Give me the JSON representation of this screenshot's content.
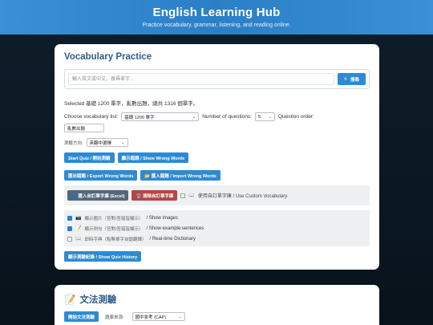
{
  "hero": {
    "title": "English Learning Hub",
    "subtitle": "Practice vocabulary, grammar, listening, and reading online."
  },
  "vocab": {
    "title": "Vocabulary Practice",
    "search_placeholder": "輸入英文或中文，搜尋單字...",
    "search_button": "🔍 搜尋",
    "selected_info": "Selected 基礎 1200 單字，亂數出題，總共 1316 個單字。",
    "list_label": "Choose vocabulary list:",
    "list_value": "基礎 1200 單字",
    "questions_label": "Number of questions:",
    "questions_value": "5",
    "order_label": "Question order:",
    "order_value": "亂數出題",
    "direction_label": "測驗方向:",
    "direction_value": "英翻中選擇",
    "start_button": "Start Quiz / 開始測驗",
    "wrong_button": "顯示錯題 / Show Wrong Words",
    "export_button": "匯出錯題 / Export Wrong Words",
    "import_button": "📂 匯入錯題 / Import Wrong Words",
    "custom_import_button": "👤 匯入自訂單字庫 (Excel)",
    "custom_clear_button": "🗑️ 清除自訂單字庫",
    "custom_use_label": "使用自訂單字庫 / Use Custom Vocabulary",
    "options": [
      {
        "zh": "顯示圖片（答對/答錯皆顯示）",
        "en": " / Show images",
        "checked": true,
        "icon": "📷"
      },
      {
        "zh": "顯示例句（答對/答錯皆顯示）",
        "en": " / Show example sentences",
        "checked": true,
        "icon": "📝"
      },
      {
        "zh": "即時字典（點擊單字自動翻譯）",
        "en": " / Real-time Dictionary",
        "checked": false,
        "icon": "📖"
      }
    ],
    "history_button": "顯示測驗紀錄 / Show Quiz History"
  },
  "grammar": {
    "title": "文法測驗",
    "start_button": "開始文法測驗",
    "source_label": "題庫來源:",
    "source_value": "國中會考 (CAP)"
  },
  "colors": {
    "hero": "#2b7fc7",
    "accent": "#2e8bd2",
    "title": "#2d5d8a",
    "danger": "#b54444"
  }
}
